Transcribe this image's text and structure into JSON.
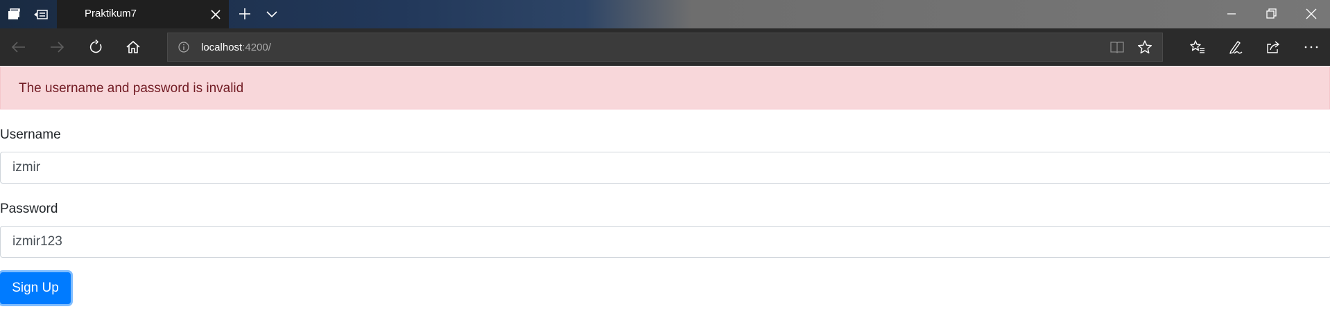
{
  "browser": {
    "tab_title": "Praktikum7",
    "url_host": "localhost",
    "url_path": ":4200/",
    "icons": {
      "tab_preview": "tab-preview-icon",
      "set_aside": "set-aside-tabs-icon",
      "close_tab": "close-icon",
      "new_tab": "plus-icon",
      "tab_list": "chevron-down-icon",
      "minimize": "minimize-icon",
      "restore": "restore-icon",
      "close_window": "close-icon",
      "back": "back-arrow-icon",
      "forward": "forward-arrow-icon",
      "refresh": "refresh-icon",
      "home": "home-icon",
      "site_info": "info-icon",
      "reading_view": "reading-view-icon",
      "favorite": "star-icon",
      "favorites_hub": "favorites-icon",
      "web_note": "pen-icon",
      "share": "share-icon",
      "more": "more-icon"
    }
  },
  "alert": {
    "message": "The username and password is invalid"
  },
  "form": {
    "username_label": "Username",
    "username_value": "izmir",
    "password_label": "Password",
    "password_value": "izmir123",
    "submit_label": "Sign Up"
  },
  "colors": {
    "alert_bg": "#f8d7da",
    "alert_text": "#721c24",
    "primary": "#007bff"
  }
}
